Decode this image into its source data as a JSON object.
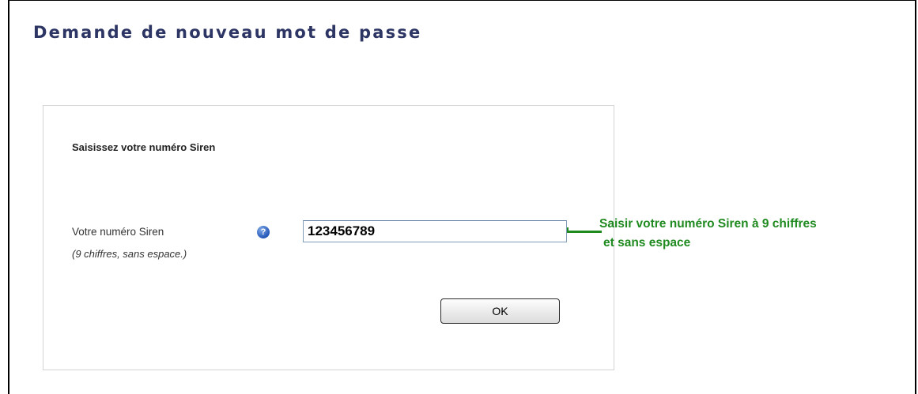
{
  "page": {
    "title": "Demande de nouveau mot de passe"
  },
  "form": {
    "heading": "Saisissez votre numéro Siren",
    "siren_label": "Votre numéro Siren",
    "siren_hint": "(9 chiffres, sans espace.)",
    "siren_value": "123456789",
    "help_icon": "question-mark-icon",
    "ok_label": "OK"
  },
  "annotation": {
    "line1": "Saisir votre numéro Siren à 9 chiffres",
    "line2": "et sans espace",
    "color": "#1f8a1f"
  },
  "colors": {
    "title": "#2c3563",
    "panel_border": "#d4d4d4",
    "help_icon": "#2457b8"
  }
}
